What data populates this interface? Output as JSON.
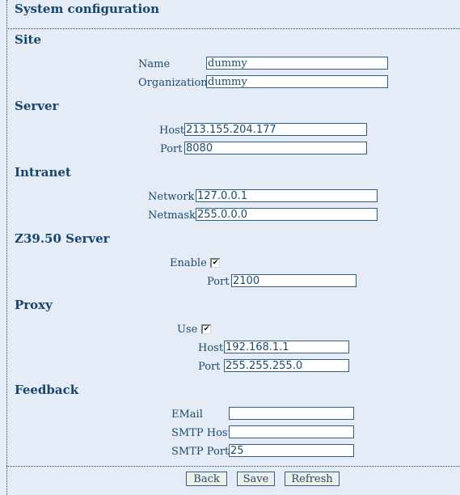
{
  "page": {
    "title": "System configuration"
  },
  "sections": {
    "site": {
      "title": "Site",
      "name_label": "Name",
      "name_value": "dummy",
      "organization_label": "Organization",
      "organization_value": "dummy"
    },
    "server": {
      "title": "Server",
      "host_label": "Host",
      "host_value": "213.155.204.177",
      "port_label": "Port",
      "port_value": "8080"
    },
    "intranet": {
      "title": "Intranet",
      "network_label": "Network",
      "network_value": "127.0.0.1",
      "netmask_label": "Netmask",
      "netmask_value": "255.0.0.0"
    },
    "z3950": {
      "title": "Z39.50 Server",
      "enable_label": "Enable",
      "enable_checked": true,
      "port_label": "Port",
      "port_value": "2100"
    },
    "proxy": {
      "title": "Proxy",
      "use_label": "Use",
      "use_checked": true,
      "host_label": "Host",
      "host_value": "192.168.1.1",
      "port_label": "Port",
      "port_value": "255.255.255.0"
    },
    "feedback": {
      "title": "Feedback",
      "email_label": "EMail",
      "email_value": "",
      "smtp_host_label": "SMTP Host",
      "smtp_host_value": "",
      "smtp_port_label": "SMTP Port",
      "smtp_port_value": "25"
    }
  },
  "actions": {
    "back_label": "Back",
    "save_label": "Save",
    "refresh_label": "Refresh"
  },
  "icons": {
    "checkmark": "✔"
  },
  "colors": {
    "background": "#e5ecf5",
    "text": "#1a4a72",
    "border": "#2a5f8c",
    "button_bg": "#efefe9"
  }
}
